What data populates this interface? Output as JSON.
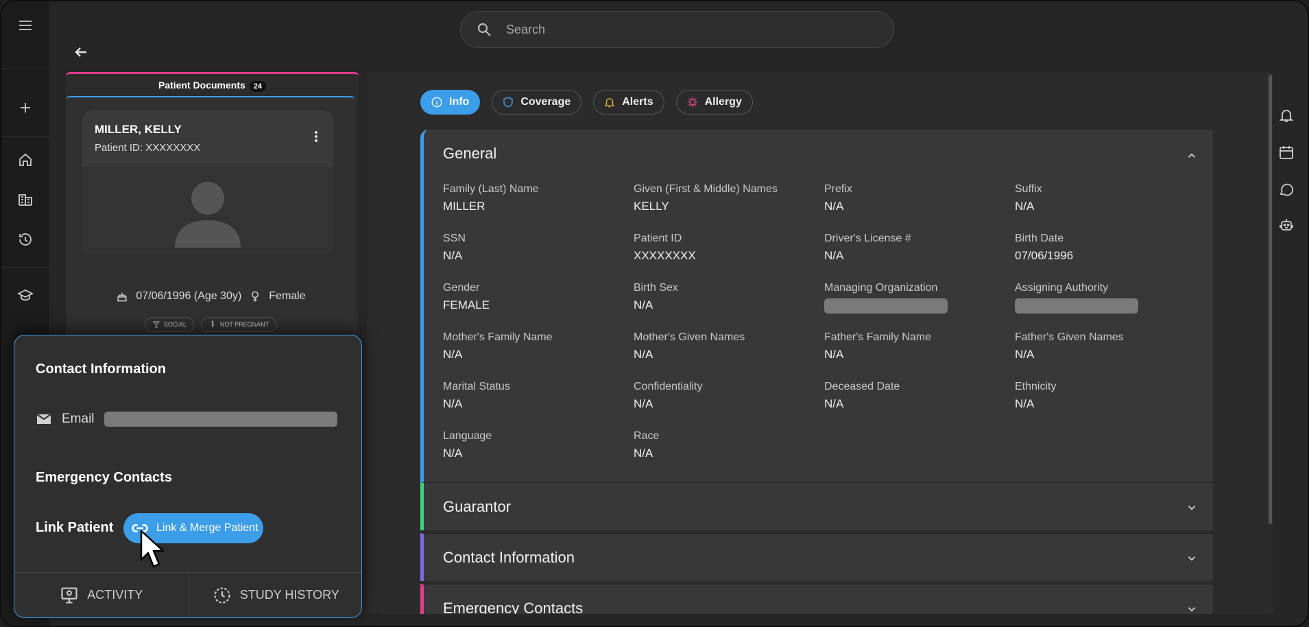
{
  "search": {
    "placeholder": "Search"
  },
  "documents": {
    "title": "Patient Documents",
    "count": "24"
  },
  "patient": {
    "name": "MILLER, KELLY",
    "patient_id_line": "Patient ID: XXXXXXXX",
    "dob": "07/06/1996 (Age 30y)",
    "sex": "Female",
    "chips": [
      "SOCIAL",
      "NOT PREGNANT"
    ]
  },
  "popover": {
    "contact_heading": "Contact Information",
    "email_label": "Email",
    "emergency_heading": "Emergency Contacts",
    "link_heading": "Link Patient",
    "link_button": "Link & Merge Patient",
    "footer_tabs": [
      "ACTIVITY",
      "STUDY HISTORY"
    ]
  },
  "tabs": [
    {
      "label": "Info",
      "active": true
    },
    {
      "label": "Coverage",
      "active": false
    },
    {
      "label": "Alerts",
      "active": false
    },
    {
      "label": "Allergy",
      "active": false
    }
  ],
  "general": {
    "title": "General",
    "fields": [
      {
        "label": "Family (Last) Name",
        "value": "MILLER"
      },
      {
        "label": "Given (First & Middle) Names",
        "value": "KELLY"
      },
      {
        "label": "Prefix",
        "value": "N/A"
      },
      {
        "label": "Suffix",
        "value": "N/A"
      },
      {
        "label": "SSN",
        "value": "N/A"
      },
      {
        "label": "Patient ID",
        "value": "XXXXXXXX"
      },
      {
        "label": "Driver's License #",
        "value": "N/A"
      },
      {
        "label": "Birth Date",
        "value": "07/06/1996"
      },
      {
        "label": "Gender",
        "value": "FEMALE"
      },
      {
        "label": "Birth Sex",
        "value": "N/A"
      },
      {
        "label": "Managing Organization",
        "value": ""
      },
      {
        "label": "Assigning Authority",
        "value": ""
      },
      {
        "label": "Mother's Family Name",
        "value": "N/A"
      },
      {
        "label": "Mother's Given Names",
        "value": "N/A"
      },
      {
        "label": "Father's Family Name",
        "value": "N/A"
      },
      {
        "label": "Father's Given Names",
        "value": "N/A"
      },
      {
        "label": "Marital Status",
        "value": "N/A"
      },
      {
        "label": "Confidentiality",
        "value": "N/A"
      },
      {
        "label": "Deceased Date",
        "value": "N/A"
      },
      {
        "label": "Ethnicity",
        "value": "N/A"
      },
      {
        "label": "Language",
        "value": "N/A"
      },
      {
        "label": "Race",
        "value": "N/A"
      }
    ]
  },
  "collapsed_sections": [
    {
      "title": "Guarantor",
      "color": "#3fd27a"
    },
    {
      "title": "Contact Information",
      "color": "#7b6ae0"
    },
    {
      "title": "Emergency Contacts",
      "color": "#e23d8a"
    }
  ],
  "colors": {
    "accent": "#3c9de8",
    "documents_bar": "#e23d8a"
  }
}
